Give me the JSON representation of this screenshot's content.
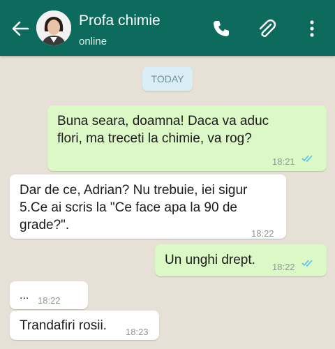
{
  "header": {
    "contact_name": "Profa chimie",
    "status": "online"
  },
  "chat": {
    "date_label": "TODAY",
    "messages": [
      {
        "direction": "outgoing",
        "text": "Buna seara, doamna! Daca va aduc\nflori, ma treceti la chimie, va rog?",
        "time": "18:21",
        "read": true
      },
      {
        "direction": "incoming",
        "text": "Dar de ce, Adrian? Nu trebuie, iei sigur\n5.Ce ai scris la \"Ce face apa la 90 de\ngrade?\".",
        "time": "18:22"
      },
      {
        "direction": "outgoing",
        "text": "Un unghi drept.",
        "time": "18:22",
        "read": true
      },
      {
        "direction": "incoming",
        "text": "...",
        "time": "18:22"
      },
      {
        "direction": "incoming",
        "text": "Trandafiri rosii.",
        "time": "18:23"
      }
    ]
  },
  "colors": {
    "header": "#0d6b5e",
    "outgoing_bubble": "#dcf8c6",
    "incoming_bubble": "#ffffff",
    "read_ticks": "#4fc3f7"
  },
  "icons": [
    "back-arrow-icon",
    "avatar",
    "phone-icon",
    "paperclip-icon",
    "more-options-icon",
    "double-check-icon"
  ]
}
